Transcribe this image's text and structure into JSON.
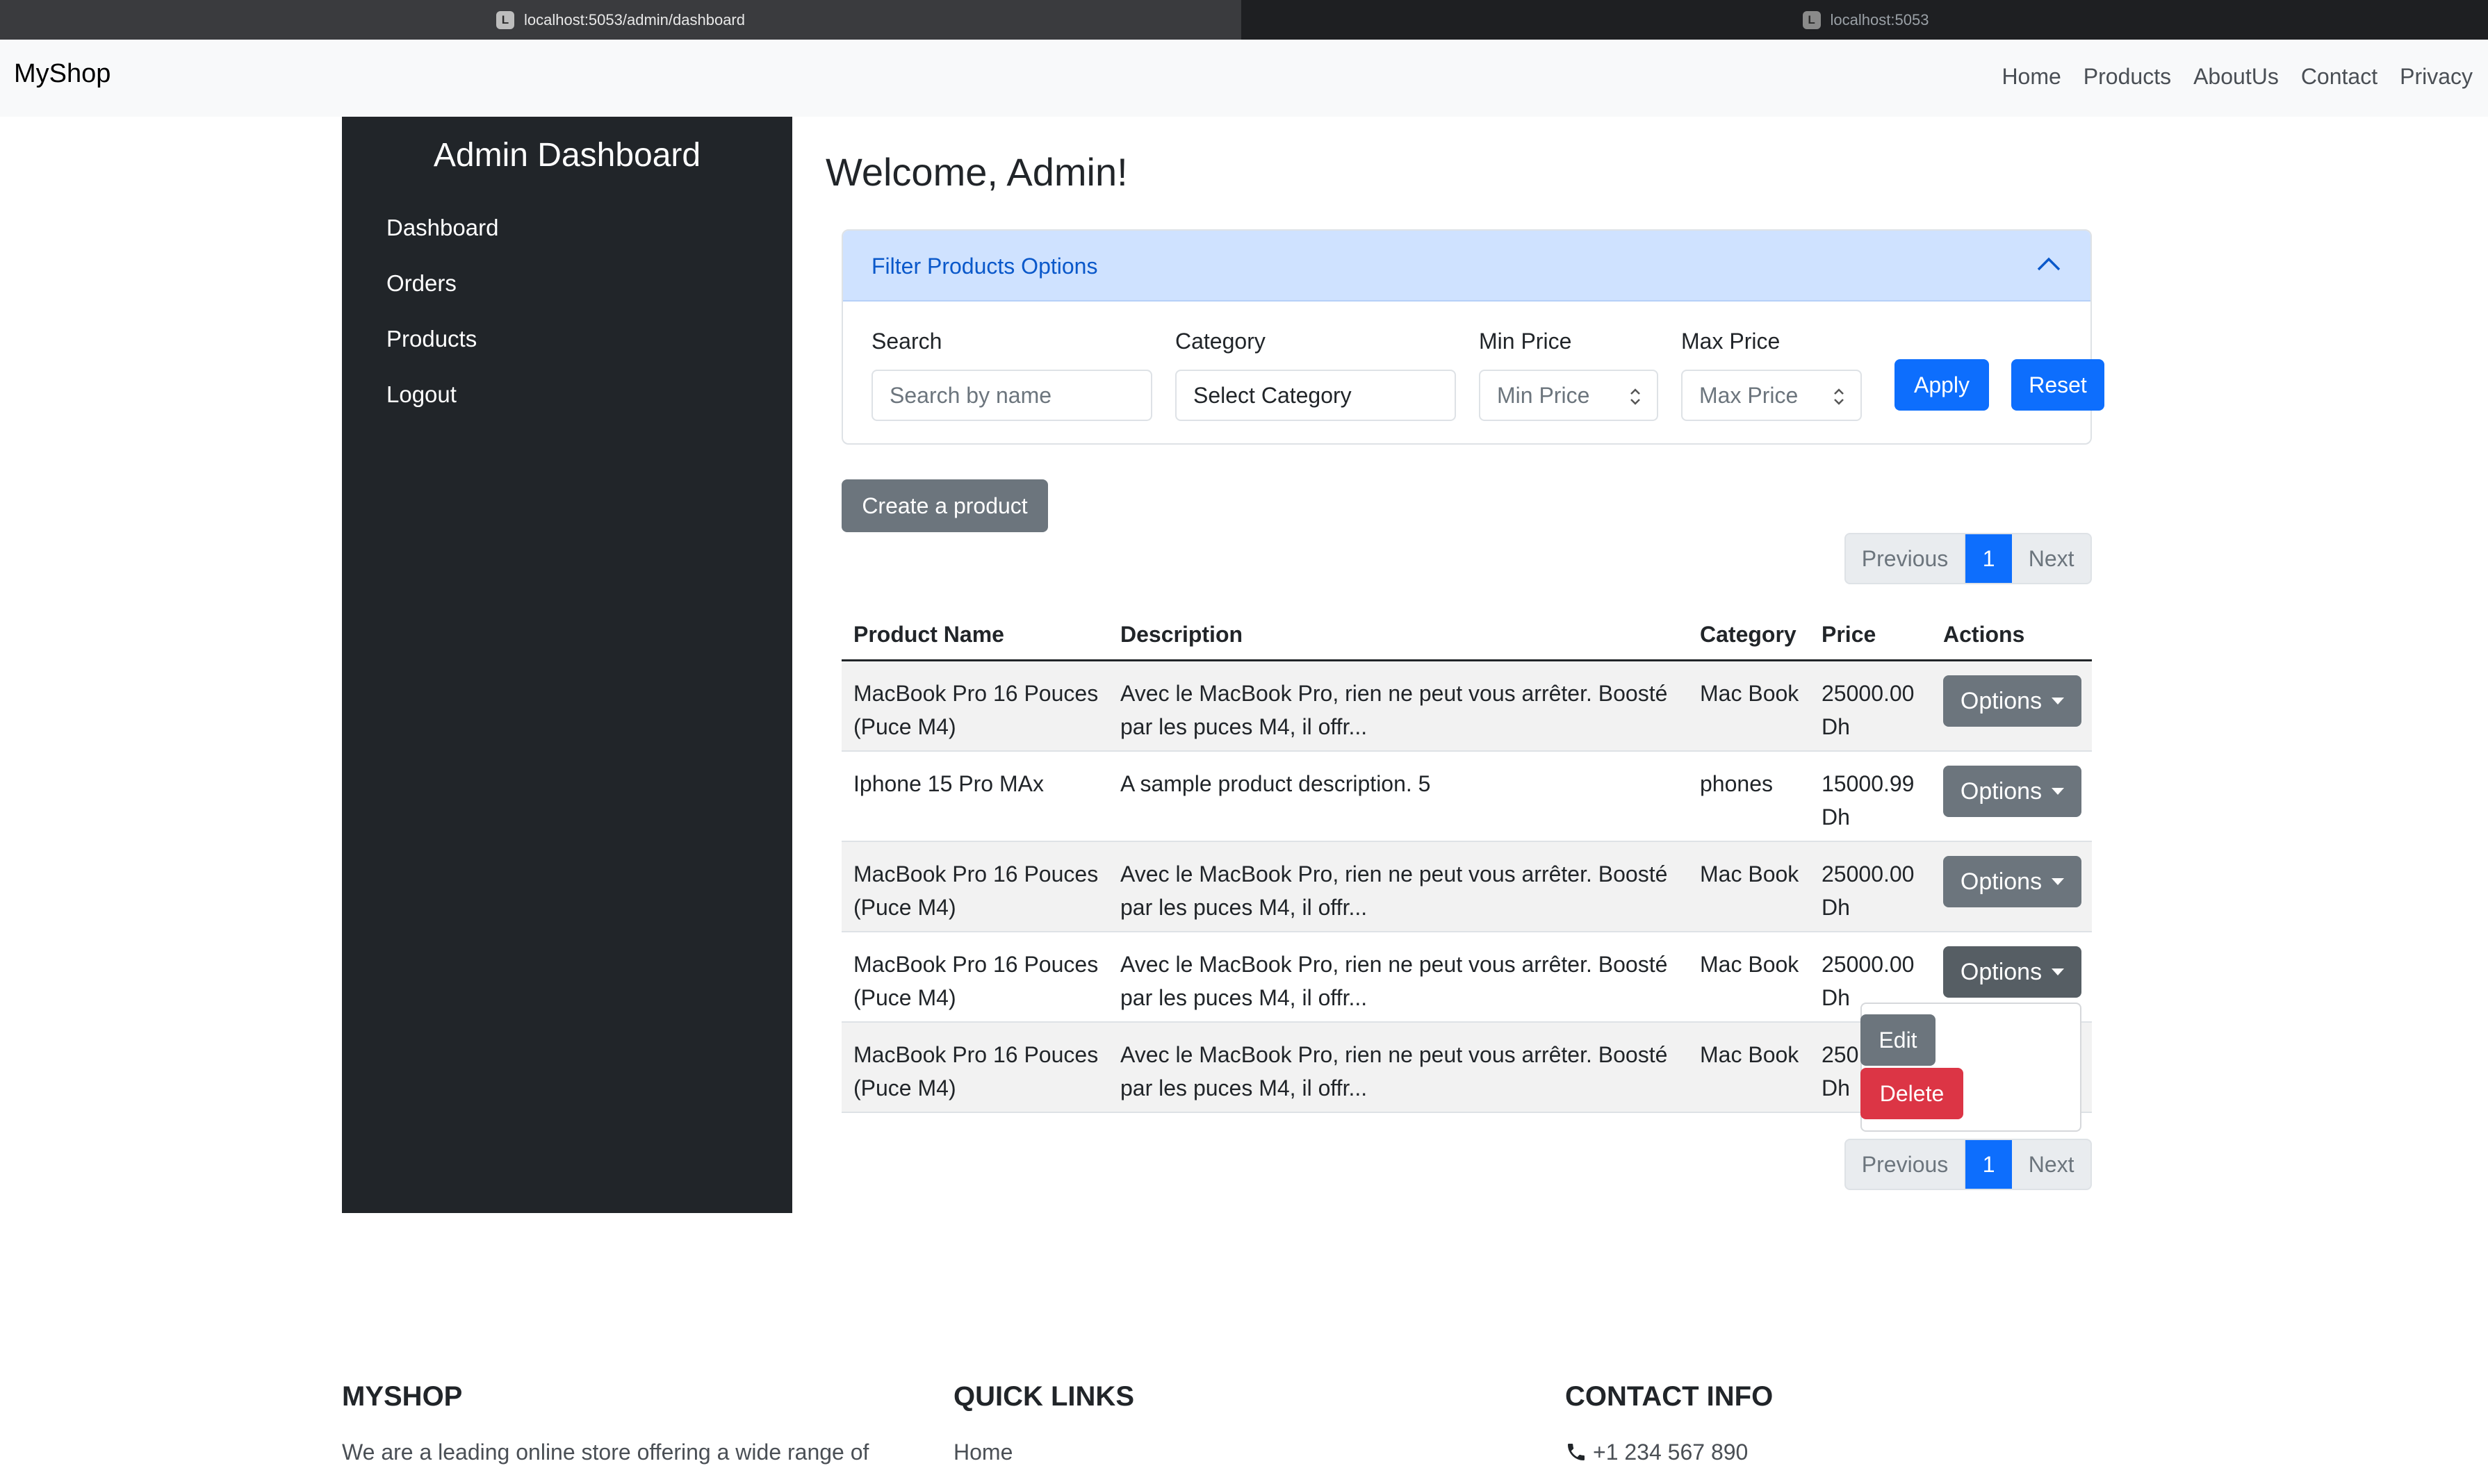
{
  "browser": {
    "tabs": [
      {
        "title": "localhost:5053/admin/dashboard",
        "favicon": "L"
      },
      {
        "title": "localhost:5053",
        "favicon": "L"
      }
    ]
  },
  "navbar": {
    "brand": "MyShop",
    "links": [
      "Home",
      "Products",
      "AboutUs",
      "Contact",
      "Privacy"
    ]
  },
  "sidebar": {
    "title": "Admin Dashboard",
    "items": [
      "Dashboard",
      "Orders",
      "Products",
      "Logout"
    ]
  },
  "main": {
    "welcome": "Welcome, Admin!",
    "filter": {
      "title": "Filter Products Options",
      "search_label": "Search",
      "search_placeholder": "Search by name",
      "category_label": "Category",
      "category_value": "Select Category",
      "min_label": "Min Price",
      "min_placeholder": "Min Price",
      "max_label": "Max Price",
      "max_placeholder": "Max Price",
      "apply": "Apply",
      "reset": "Reset"
    },
    "create_button": "Create a product",
    "pagination": {
      "previous": "Previous",
      "page": "1",
      "next": "Next"
    },
    "table": {
      "headers": [
        "Product Name",
        "Description",
        "Category",
        "Price",
        "Actions"
      ],
      "rows": [
        {
          "name1": "MacBook Pro 16 Pouces",
          "name2": "(Puce M4)",
          "desc1": "Avec le MacBook Pro, rien ne peut vous arrêter. Boosté",
          "desc2": "par les puces M4, il offr...",
          "category": "Mac Book",
          "price1": "25000.00",
          "price2": "Dh",
          "action": "Options"
        },
        {
          "name1": "Iphone 15 Pro MAx",
          "name2": "",
          "desc1": "A sample product description. 5",
          "desc2": "",
          "category": "phones",
          "price1": "15000.99",
          "price2": "Dh",
          "action": "Options"
        },
        {
          "name1": "MacBook Pro 16 Pouces",
          "name2": "(Puce M4)",
          "desc1": "Avec le MacBook Pro, rien ne peut vous arrêter. Boosté",
          "desc2": "par les puces M4, il offr...",
          "category": "Mac Book",
          "price1": "25000.00",
          "price2": "Dh",
          "action": "Options"
        },
        {
          "name1": "MacBook Pro 16 Pouces",
          "name2": "(Puce M4)",
          "desc1": "Avec le MacBook Pro, rien ne peut vous arrêter. Boosté",
          "desc2": "par les puces M4, il offr...",
          "category": "Mac Book",
          "price1": "25000.00",
          "price2": "Dh",
          "action": "Options"
        },
        {
          "name1": "MacBook Pro 16 Pouces",
          "name2": "(Puce M4)",
          "desc1": "Avec le MacBook Pro, rien ne peut vous arrêter. Boosté",
          "desc2": "par les puces M4, il offr...",
          "category": "Mac Book",
          "price1": "250",
          "price2": "Dh",
          "action": ""
        }
      ]
    },
    "dropdown": {
      "edit": "Edit",
      "delete": "Delete"
    }
  },
  "footer": {
    "brand_title": "MYSHOP",
    "brand_text": "We are a leading online store offering a wide range of",
    "links_title": "QUICK LINKS",
    "links": [
      "Home"
    ],
    "contact_title": "CONTACT INFO",
    "phone": "+1 234 567 890"
  },
  "colors": {
    "primary": "#0d6efd",
    "secondary": "#6c757d",
    "danger": "#dc3545",
    "sidebar": "#212529",
    "accordion_header": "#cfe2ff"
  },
  "icons": [
    "chevron-up-icon",
    "caret-down-icon",
    "phone-icon",
    "envelope-icon",
    "spinner-arrows-icon"
  ]
}
